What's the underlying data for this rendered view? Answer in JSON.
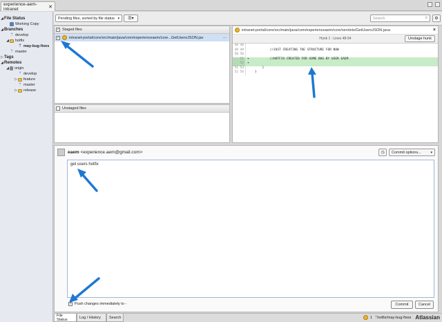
{
  "tab": {
    "title": "experience-aem-intranet",
    "close": "✕"
  },
  "sidebar": {
    "file_status": "File Status",
    "working_copy": "Working Copy",
    "branches": "Branches",
    "branch_items": [
      "develop",
      "hotfix",
      "may-bug-fixes",
      "master"
    ],
    "tags": "Tags",
    "remotes": "Remotes",
    "remote_origin": "origin",
    "remote_items": [
      "develop",
      "feature",
      "master",
      "release"
    ]
  },
  "toolbar": {
    "pending_label": "Pending files, sorted by file status",
    "search_placeholder": "Search"
  },
  "staged": {
    "header": "Staged files",
    "file_path": "intranet-portal/core/src/main/java/com/experienceaem/core...GetUsersJSON.jav",
    "more": "···"
  },
  "unstaged": {
    "header": "Unstaged files"
  },
  "diff": {
    "file_path": "intranet-portal/core/src/main/java/com/experienceaem/core/servlets/GetUsersJSON.java",
    "hunk_label": "Hunk 1 : Lines 48-54",
    "unstage_label": "Unstage hunk",
    "lines": [
      {
        "a": "48",
        "b": "48",
        "code": "",
        "added": false
      },
      {
        "a": "49",
        "b": "49",
        "code": "            //JUST CREATING THE STRUCTURE FOR NOW",
        "added": false
      },
      {
        "a": "50",
        "b": "50",
        "code": "",
        "added": false
      },
      {
        "a": "",
        "b": "51",
        "code": "+           //HOTFIX CREATED FOR SOME BUG BY USER EAEM",
        "added": true
      },
      {
        "a": "",
        "b": "52",
        "code": "+",
        "added": true
      },
      {
        "a": "51",
        "b": "53",
        "code": "        }",
        "added": false
      },
      {
        "a": "52",
        "b": "54",
        "code": "    }",
        "added": false
      }
    ]
  },
  "commit": {
    "author_name": "eaem",
    "author_email": "<experience.aem@gmail.com>",
    "options_label": "Commit options...",
    "message": "get users hotfix",
    "push_label": "Push changes immediately to -",
    "commit_label": "Commit",
    "cancel_label": "Cancel"
  },
  "bottom_tabs": [
    "File Status",
    "Log / History",
    "Search"
  ],
  "status": {
    "count": "1",
    "branch": "hotfix/may-bug-fixes",
    "brand": "Atlassian"
  },
  "colors": {
    "selection": "#cfe0f5",
    "added_line": "#c8ebc8",
    "arrow": "#1e78d2"
  }
}
